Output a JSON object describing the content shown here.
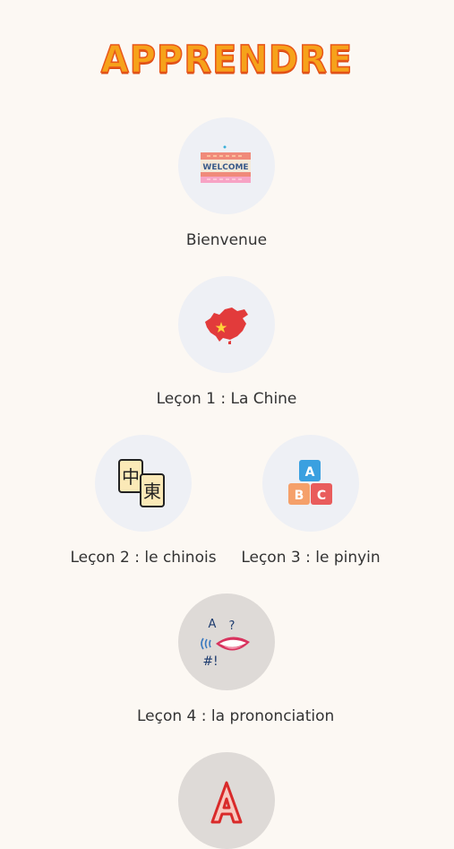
{
  "header": {
    "title": "APPRENDRE"
  },
  "lessons": [
    {
      "label": "Bienvenue",
      "icon": "welcome-sign-icon",
      "sign_text": "WELCOME"
    },
    {
      "label": "Leçon 1 : La Chine",
      "icon": "china-map-icon"
    },
    {
      "label": "Leçon 2 : le chinois",
      "icon": "chinese-characters-icon",
      "glyphs": [
        "中",
        "東"
      ]
    },
    {
      "label": "Leçon 3 : le pinyin",
      "icon": "abc-blocks-icon",
      "blocks": [
        "A",
        "B",
        "C"
      ]
    },
    {
      "label": "Leçon 4 : la prononciation",
      "icon": "mouth-speaking-icon",
      "symbols": [
        "A",
        "?",
        "#!"
      ]
    },
    {
      "label": "",
      "icon": "letter-a-icon",
      "glyph": "A"
    }
  ],
  "colors": {
    "background": "#fcf8f3",
    "circle": "#eef0f5",
    "circle_locked": "#dedad7",
    "title_fill": "#f6a21a",
    "title_outline": "#e8571a"
  }
}
